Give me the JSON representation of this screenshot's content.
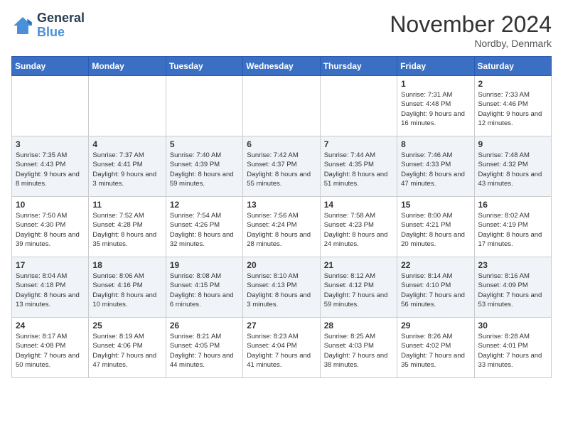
{
  "logo": {
    "line1": "General",
    "line2": "Blue"
  },
  "title": "November 2024",
  "location": "Nordby, Denmark",
  "days_of_week": [
    "Sunday",
    "Monday",
    "Tuesday",
    "Wednesday",
    "Thursday",
    "Friday",
    "Saturday"
  ],
  "weeks": [
    [
      {
        "day": "",
        "info": ""
      },
      {
        "day": "",
        "info": ""
      },
      {
        "day": "",
        "info": ""
      },
      {
        "day": "",
        "info": ""
      },
      {
        "day": "",
        "info": ""
      },
      {
        "day": "1",
        "info": "Sunrise: 7:31 AM\nSunset: 4:48 PM\nDaylight: 9 hours\nand 16 minutes."
      },
      {
        "day": "2",
        "info": "Sunrise: 7:33 AM\nSunset: 4:46 PM\nDaylight: 9 hours\nand 12 minutes."
      }
    ],
    [
      {
        "day": "3",
        "info": "Sunrise: 7:35 AM\nSunset: 4:43 PM\nDaylight: 9 hours\nand 8 minutes."
      },
      {
        "day": "4",
        "info": "Sunrise: 7:37 AM\nSunset: 4:41 PM\nDaylight: 9 hours\nand 3 minutes."
      },
      {
        "day": "5",
        "info": "Sunrise: 7:40 AM\nSunset: 4:39 PM\nDaylight: 8 hours\nand 59 minutes."
      },
      {
        "day": "6",
        "info": "Sunrise: 7:42 AM\nSunset: 4:37 PM\nDaylight: 8 hours\nand 55 minutes."
      },
      {
        "day": "7",
        "info": "Sunrise: 7:44 AM\nSunset: 4:35 PM\nDaylight: 8 hours\nand 51 minutes."
      },
      {
        "day": "8",
        "info": "Sunrise: 7:46 AM\nSunset: 4:33 PM\nDaylight: 8 hours\nand 47 minutes."
      },
      {
        "day": "9",
        "info": "Sunrise: 7:48 AM\nSunset: 4:32 PM\nDaylight: 8 hours\nand 43 minutes."
      }
    ],
    [
      {
        "day": "10",
        "info": "Sunrise: 7:50 AM\nSunset: 4:30 PM\nDaylight: 8 hours\nand 39 minutes."
      },
      {
        "day": "11",
        "info": "Sunrise: 7:52 AM\nSunset: 4:28 PM\nDaylight: 8 hours\nand 35 minutes."
      },
      {
        "day": "12",
        "info": "Sunrise: 7:54 AM\nSunset: 4:26 PM\nDaylight: 8 hours\nand 32 minutes."
      },
      {
        "day": "13",
        "info": "Sunrise: 7:56 AM\nSunset: 4:24 PM\nDaylight: 8 hours\nand 28 minutes."
      },
      {
        "day": "14",
        "info": "Sunrise: 7:58 AM\nSunset: 4:23 PM\nDaylight: 8 hours\nand 24 minutes."
      },
      {
        "day": "15",
        "info": "Sunrise: 8:00 AM\nSunset: 4:21 PM\nDaylight: 8 hours\nand 20 minutes."
      },
      {
        "day": "16",
        "info": "Sunrise: 8:02 AM\nSunset: 4:19 PM\nDaylight: 8 hours\nand 17 minutes."
      }
    ],
    [
      {
        "day": "17",
        "info": "Sunrise: 8:04 AM\nSunset: 4:18 PM\nDaylight: 8 hours\nand 13 minutes."
      },
      {
        "day": "18",
        "info": "Sunrise: 8:06 AM\nSunset: 4:16 PM\nDaylight: 8 hours\nand 10 minutes."
      },
      {
        "day": "19",
        "info": "Sunrise: 8:08 AM\nSunset: 4:15 PM\nDaylight: 8 hours\nand 6 minutes."
      },
      {
        "day": "20",
        "info": "Sunrise: 8:10 AM\nSunset: 4:13 PM\nDaylight: 8 hours\nand 3 minutes."
      },
      {
        "day": "21",
        "info": "Sunrise: 8:12 AM\nSunset: 4:12 PM\nDaylight: 7 hours\nand 59 minutes."
      },
      {
        "day": "22",
        "info": "Sunrise: 8:14 AM\nSunset: 4:10 PM\nDaylight: 7 hours\nand 56 minutes."
      },
      {
        "day": "23",
        "info": "Sunrise: 8:16 AM\nSunset: 4:09 PM\nDaylight: 7 hours\nand 53 minutes."
      }
    ],
    [
      {
        "day": "24",
        "info": "Sunrise: 8:17 AM\nSunset: 4:08 PM\nDaylight: 7 hours\nand 50 minutes."
      },
      {
        "day": "25",
        "info": "Sunrise: 8:19 AM\nSunset: 4:06 PM\nDaylight: 7 hours\nand 47 minutes."
      },
      {
        "day": "26",
        "info": "Sunrise: 8:21 AM\nSunset: 4:05 PM\nDaylight: 7 hours\nand 44 minutes."
      },
      {
        "day": "27",
        "info": "Sunrise: 8:23 AM\nSunset: 4:04 PM\nDaylight: 7 hours\nand 41 minutes."
      },
      {
        "day": "28",
        "info": "Sunrise: 8:25 AM\nSunset: 4:03 PM\nDaylight: 7 hours\nand 38 minutes."
      },
      {
        "day": "29",
        "info": "Sunrise: 8:26 AM\nSunset: 4:02 PM\nDaylight: 7 hours\nand 35 minutes."
      },
      {
        "day": "30",
        "info": "Sunrise: 8:28 AM\nSunset: 4:01 PM\nDaylight: 7 hours\nand 33 minutes."
      }
    ]
  ]
}
